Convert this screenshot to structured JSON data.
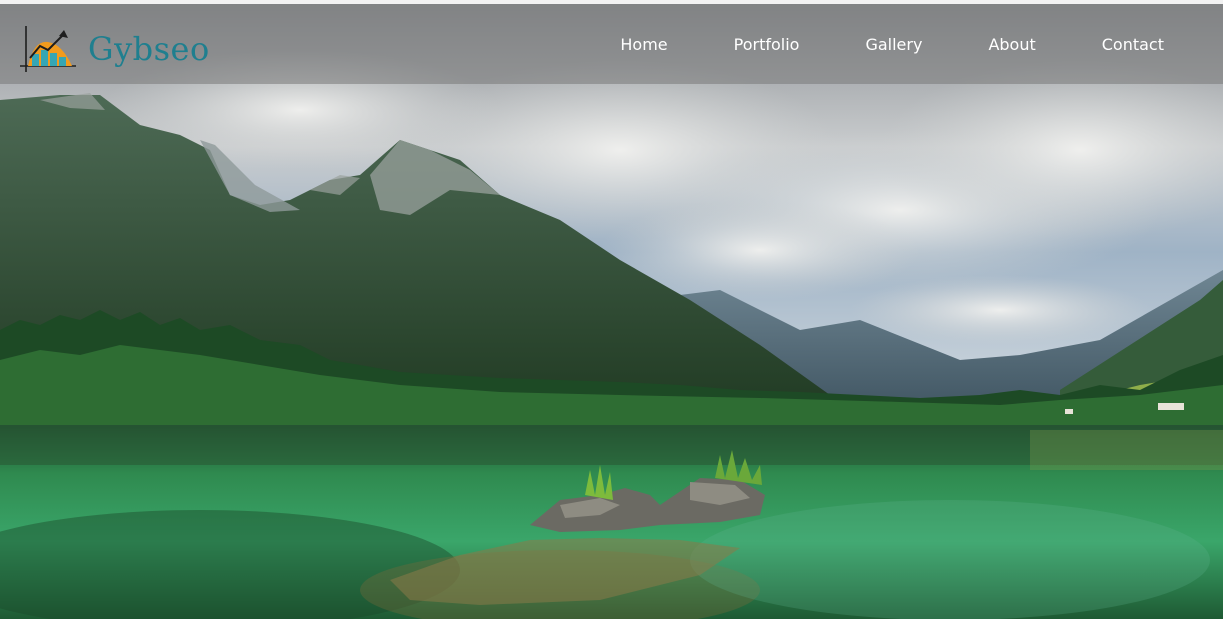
{
  "brand": {
    "name": "Gybseo",
    "logo_icon": "growth-chart-icon",
    "colors": {
      "brand_text": "#1f7f8f",
      "logo_orange": "#f29b1d",
      "logo_teal": "#36a6b4"
    }
  },
  "nav": {
    "items": [
      {
        "label": "Home"
      },
      {
        "label": "Portfolio"
      },
      {
        "label": "Gallery"
      },
      {
        "label": "About"
      },
      {
        "label": "Contact"
      }
    ]
  },
  "hero": {
    "image": "mountain-lake-landscape"
  }
}
